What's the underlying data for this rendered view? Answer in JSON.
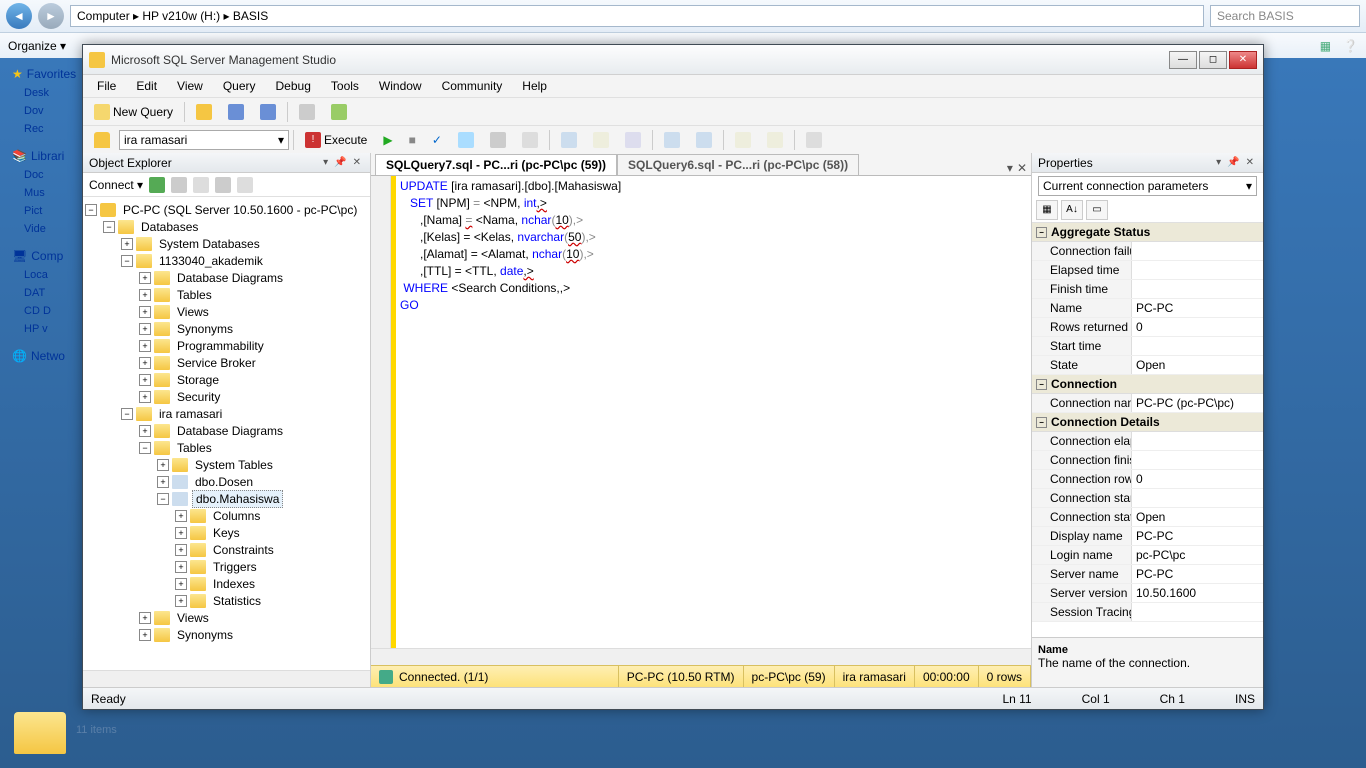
{
  "explorer": {
    "breadcrumb": "Computer  ▸  HP v210w (H:)  ▸  BASIS",
    "search_placeholder": "Search BASIS",
    "organize": "Organize ▾",
    "favorites": "Favorites",
    "items": [
      "Desk",
      "Dov",
      "Rec"
    ],
    "libraries": "Librari",
    "lib_items": [
      "Doc",
      "Mus",
      "Pict",
      "Vide"
    ],
    "computer": "Comp",
    "comp_items": [
      "Loca",
      "DAT",
      "CD D",
      "HP v"
    ],
    "network": "Netwo",
    "count": "11 items"
  },
  "ssms": {
    "title": "Microsoft SQL Server Management Studio",
    "menus": [
      "File",
      "Edit",
      "View",
      "Query",
      "Debug",
      "Tools",
      "Window",
      "Community",
      "Help"
    ],
    "new_query": "New Query",
    "db_selected": "ira ramasari",
    "execute": "Execute",
    "oe_title": "Object Explorer",
    "connect": "Connect ▾",
    "tree": {
      "server": "PC-PC (SQL Server 10.50.1600 - pc-PC\\pc)",
      "databases": "Databases",
      "sysdb": "System Databases",
      "db1": "1133040_akademik",
      "db1_items": [
        "Database Diagrams",
        "Tables",
        "Views",
        "Synonyms",
        "Programmability",
        "Service Broker",
        "Storage",
        "Security"
      ],
      "db2": "ira ramasari",
      "db2_diag": "Database Diagrams",
      "db2_tables": "Tables",
      "systables": "System Tables",
      "dosen": "dbo.Dosen",
      "mhs": "dbo.Mahasiswa",
      "mhs_items": [
        "Columns",
        "Keys",
        "Constraints",
        "Triggers",
        "Indexes",
        "Statistics"
      ],
      "db2_views": "Views",
      "db2_syn": "Synonyms"
    },
    "tabs": {
      "active": "SQLQuery7.sql - PC...ri (pc-PC\\pc (59))",
      "other": "SQLQuery6.sql - PC...ri (pc-PC\\pc (58))"
    },
    "sql": {
      "l1a": "UPDATE",
      "l1b": " [ira ramasari].[dbo].[Mahasiswa]",
      "l2a": "   SET",
      "l2b": " [NPM] ",
      "l2c": "=",
      "l2d": " <NPM, ",
      "l2e": "int",
      "l2f": ",>",
      "l3a": "      ,[Nama] ",
      "l3b": "=",
      "l3c": " <Nama, ",
      "l3d": "nchar",
      "l3e": "(",
      "l3f": "10",
      "l3g": "),>",
      "l4a": "      ,[Kelas] = <Kelas, ",
      "l4b": "nvarchar",
      "l4c": "(",
      "l4d": "50",
      "l4e": "),>",
      "l5a": "      ,[Alamat] = <Alamat, ",
      "l5b": "nchar",
      "l5c": "(",
      "l5d": "10",
      "l5e": "),>",
      "l6a": "      ,[TTL] = <TTL, ",
      "l6b": "date",
      "l6c": ",>",
      "l7a": " WHERE",
      "l7b": " <Search Conditions,,>",
      "l8": "GO"
    },
    "connbar": {
      "status": "Connected. (1/1)",
      "server": "PC-PC (10.50 RTM)",
      "user": "pc-PC\\pc (59)",
      "db": "ira ramasari",
      "time": "00:00:00",
      "rows": "0 rows"
    },
    "props": {
      "title": "Properties",
      "combo": "Current connection parameters",
      "cat1": "Aggregate Status",
      "rows1": [
        {
          "k": "Connection failur",
          "v": ""
        },
        {
          "k": "Elapsed time",
          "v": ""
        },
        {
          "k": "Finish time",
          "v": ""
        },
        {
          "k": "Name",
          "v": "PC-PC"
        },
        {
          "k": "Rows returned",
          "v": "0"
        },
        {
          "k": "Start time",
          "v": ""
        },
        {
          "k": "State",
          "v": "Open"
        }
      ],
      "cat2": "Connection",
      "rows2": [
        {
          "k": "Connection name",
          "v": "PC-PC (pc-PC\\pc)"
        }
      ],
      "cat3": "Connection Details",
      "rows3": [
        {
          "k": "Connection elaps",
          "v": ""
        },
        {
          "k": "Connection finish",
          "v": ""
        },
        {
          "k": "Connection rows",
          "v": "0"
        },
        {
          "k": "Connection start",
          "v": ""
        },
        {
          "k": "Connection state",
          "v": "Open"
        },
        {
          "k": "Display name",
          "v": "PC-PC"
        },
        {
          "k": "Login name",
          "v": "pc-PC\\pc"
        },
        {
          "k": "Server name",
          "v": "PC-PC"
        },
        {
          "k": "Server version",
          "v": "10.50.1600"
        },
        {
          "k": "Session Tracing ID",
          "v": ""
        }
      ],
      "desc_title": "Name",
      "desc_body": "The name of the connection."
    },
    "status": {
      "ready": "Ready",
      "ln": "Ln 11",
      "col": "Col 1",
      "ch": "Ch 1",
      "ins": "INS"
    }
  }
}
